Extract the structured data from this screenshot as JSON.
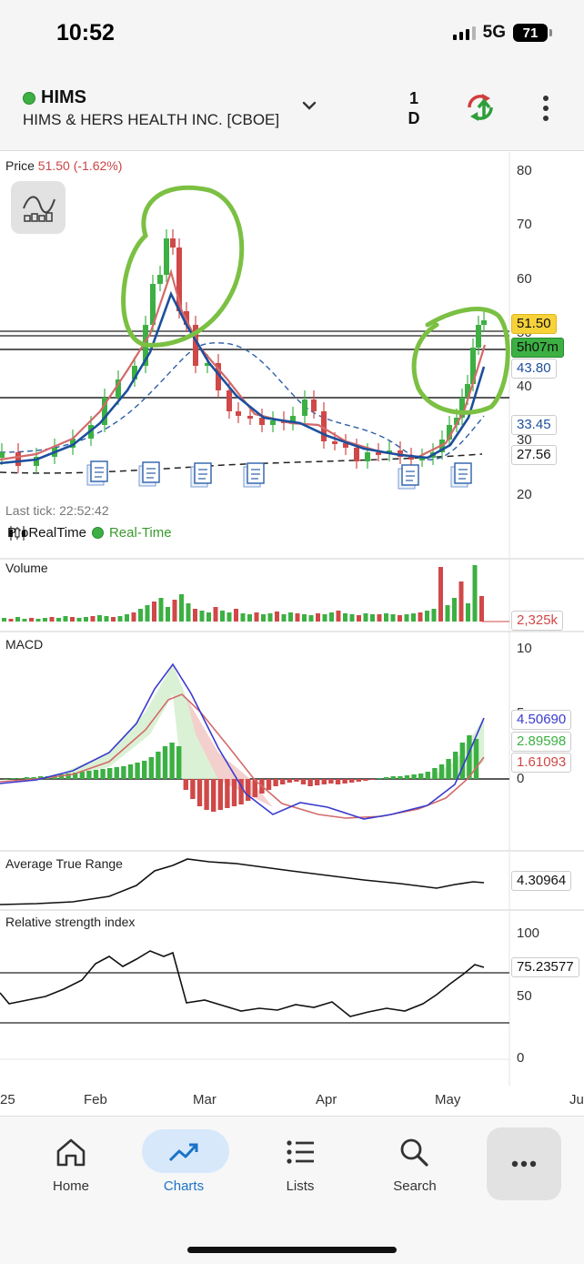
{
  "status_bar": {
    "time": "10:52",
    "network": "5G",
    "battery": "71"
  },
  "header": {
    "symbol": "HIMS",
    "company": "HIMS & HERS HEALTH INC. [CBOE]",
    "period": "1\nD",
    "period_num": "1",
    "period_unit": "D"
  },
  "price_panel": {
    "label": "Price",
    "value": "51.50",
    "change": "(-1.62%)",
    "last_tick": "Last tick: 22:52:42",
    "provider": "ProRealTime",
    "realtime": "Real-Time",
    "y_ticks": [
      "80",
      "70",
      "60",
      "50",
      "40",
      "30",
      "20"
    ],
    "tags": {
      "price": "51.50",
      "countdown": "5h07m",
      "ma_fast": "43.80",
      "ma_bb": "33.45",
      "ma_slow": "27.56"
    }
  },
  "volume_panel": {
    "label": "Volume",
    "value": "2,325k"
  },
  "macd_panel": {
    "label": "MACD",
    "y_ticks": [
      "10",
      "5",
      "0"
    ],
    "macd": "4.50690",
    "hist": "2.89598",
    "signal": "1.61093"
  },
  "atr_panel": {
    "label": "Average True Range",
    "value": "4.30964"
  },
  "rsi_panel": {
    "label": "Relative strength index",
    "y_ticks": [
      "100",
      "50",
      "0"
    ],
    "value": "75.23577"
  },
  "x_axis": {
    "months": [
      "25",
      "Feb",
      "Mar",
      "Apr",
      "May",
      "Ju"
    ]
  },
  "nav": {
    "home": "Home",
    "charts": "Charts",
    "lists": "Lists",
    "search": "Search"
  },
  "colors": {
    "up": "#3cb043",
    "down": "#d04848",
    "ma_dark": "#1c4f9c",
    "ma_red": "#d46a6a",
    "annotation": "#7bc043",
    "price_tag": "#f7d23a",
    "countdown_tag": "#3cb043"
  },
  "chart_data": {
    "type": "candlestick",
    "timeframe": "1 D",
    "x": [
      "2025-01-15",
      "2025-01-22",
      "2025-01-29",
      "2025-02-05",
      "2025-02-12",
      "2025-02-19",
      "2025-02-26",
      "2025-03-05",
      "2025-03-12",
      "2025-03-19",
      "2025-03-26",
      "2025-04-02",
      "2025-04-09",
      "2025-04-16",
      "2025-04-23",
      "2025-04-30",
      "2025-05-07",
      "2025-05-09"
    ],
    "series": [
      {
        "name": "Price",
        "values": [
          26,
          28,
          30,
          36,
          55,
          62,
          45,
          40,
          32,
          33,
          35,
          30,
          27,
          27,
          26,
          28,
          41,
          51.5
        ]
      }
    ],
    "ylim": [
      20,
      80
    ],
    "volume_last": "2,325k",
    "macd_last": {
      "macd": 4.5069,
      "histogram": 2.89598,
      "signal": 1.61093
    },
    "macd_ylim": [
      -5,
      10
    ],
    "atr_last": 4.30964,
    "rsi_last": 75.23577,
    "rsi_ylim": [
      0,
      100
    ]
  }
}
